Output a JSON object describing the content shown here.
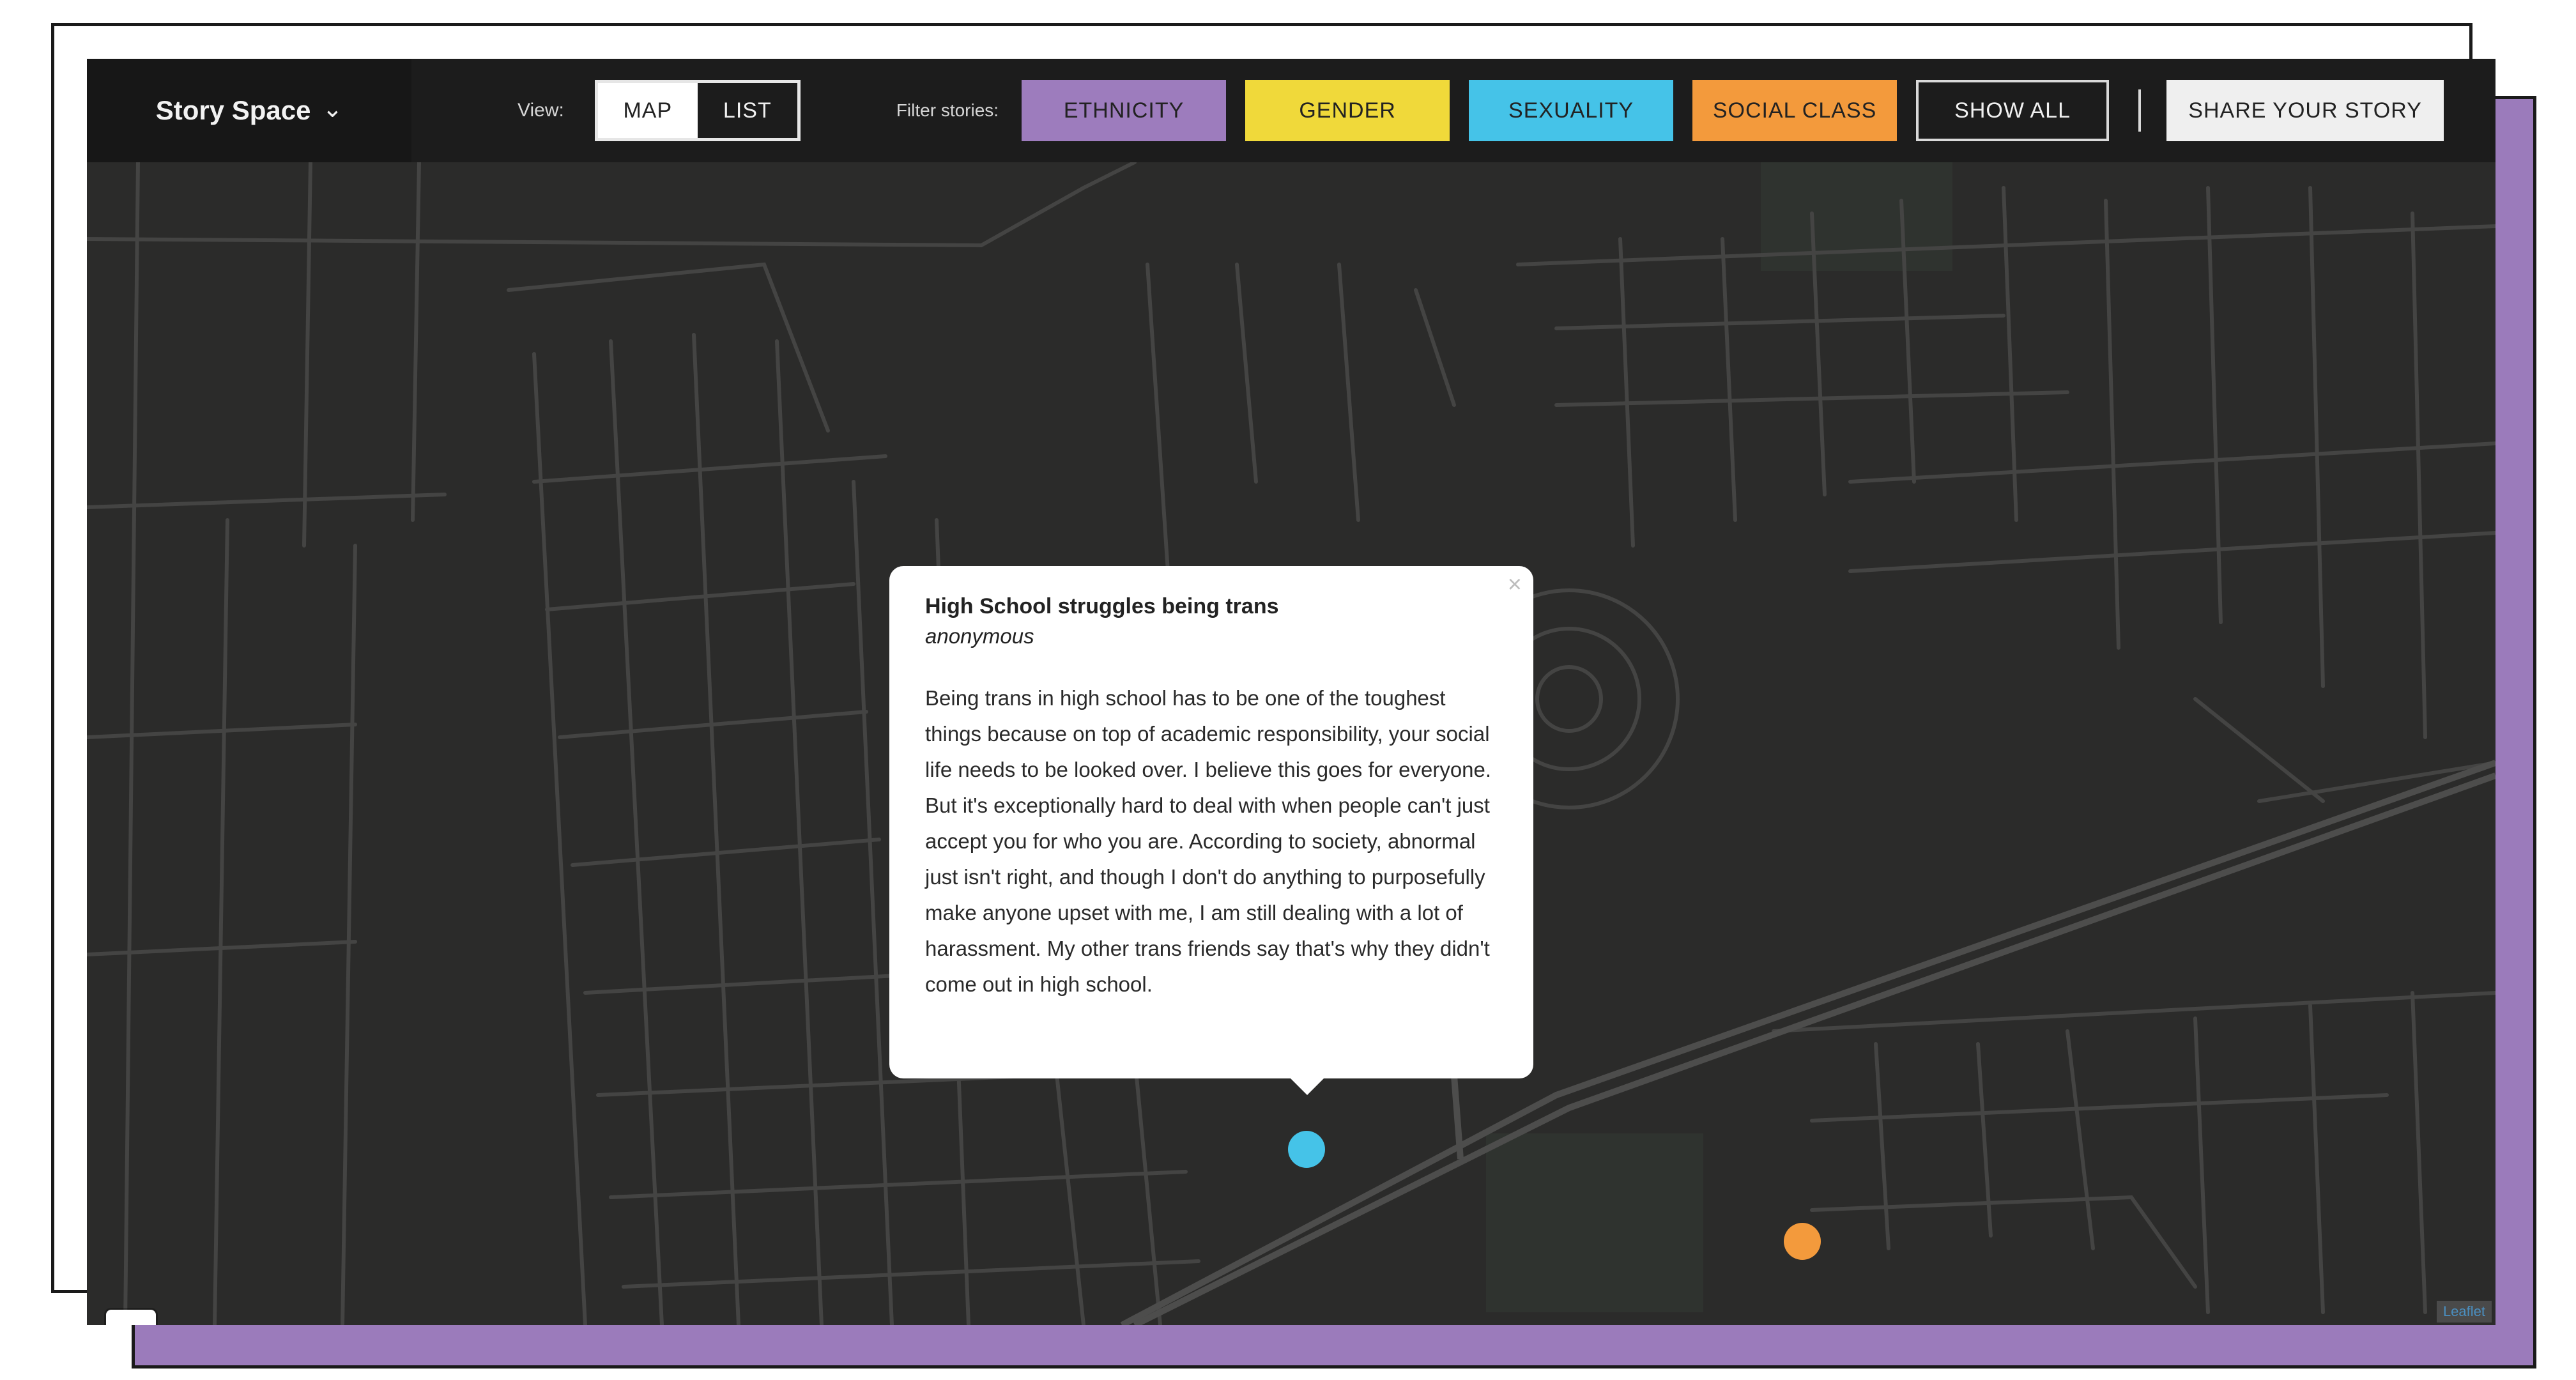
{
  "colors": {
    "accent": "#9b7bbb",
    "ethnicity": "#9d7cbd",
    "gender": "#f0d93a",
    "sexuality": "#45c3e8",
    "social_class": "#f39a3c",
    "map_bg": "#2b2b2a",
    "road": "#444443",
    "highway": "#4d4d4c"
  },
  "header": {
    "brand": "Story Space",
    "brand_icon": "chevron-down-icon",
    "view_label": "View:",
    "view_map": "MAP",
    "view_list": "LIST",
    "filter_label": "Filter stories:",
    "filters": [
      {
        "label": "ETHNICITY"
      },
      {
        "label": "GENDER"
      },
      {
        "label": "SEXUALITY"
      },
      {
        "label": "SOCIAL CLASS"
      }
    ],
    "show_all": "SHOW ALL",
    "share": "SHARE YOUR STORY"
  },
  "popup": {
    "title": "High School struggles being trans",
    "author": "anonymous",
    "close_icon": "close-icon",
    "body": "Being trans in high school has to be one of the toughest things because on top of academic responsibility, your social life needs to be looked over. I believe this goes for everyone. But it's exceptionally hard to deal with when people can't just accept you for who you are. According to society, abnormal just isn't right, and though I don't do anything to purposefully make anyone upset with me, I am still dealing with a lot of harassment. My other trans friends say that's why they didn't come out in high school."
  },
  "zoom": {
    "in": "+",
    "out": "−"
  },
  "attribution": "Leaflet"
}
